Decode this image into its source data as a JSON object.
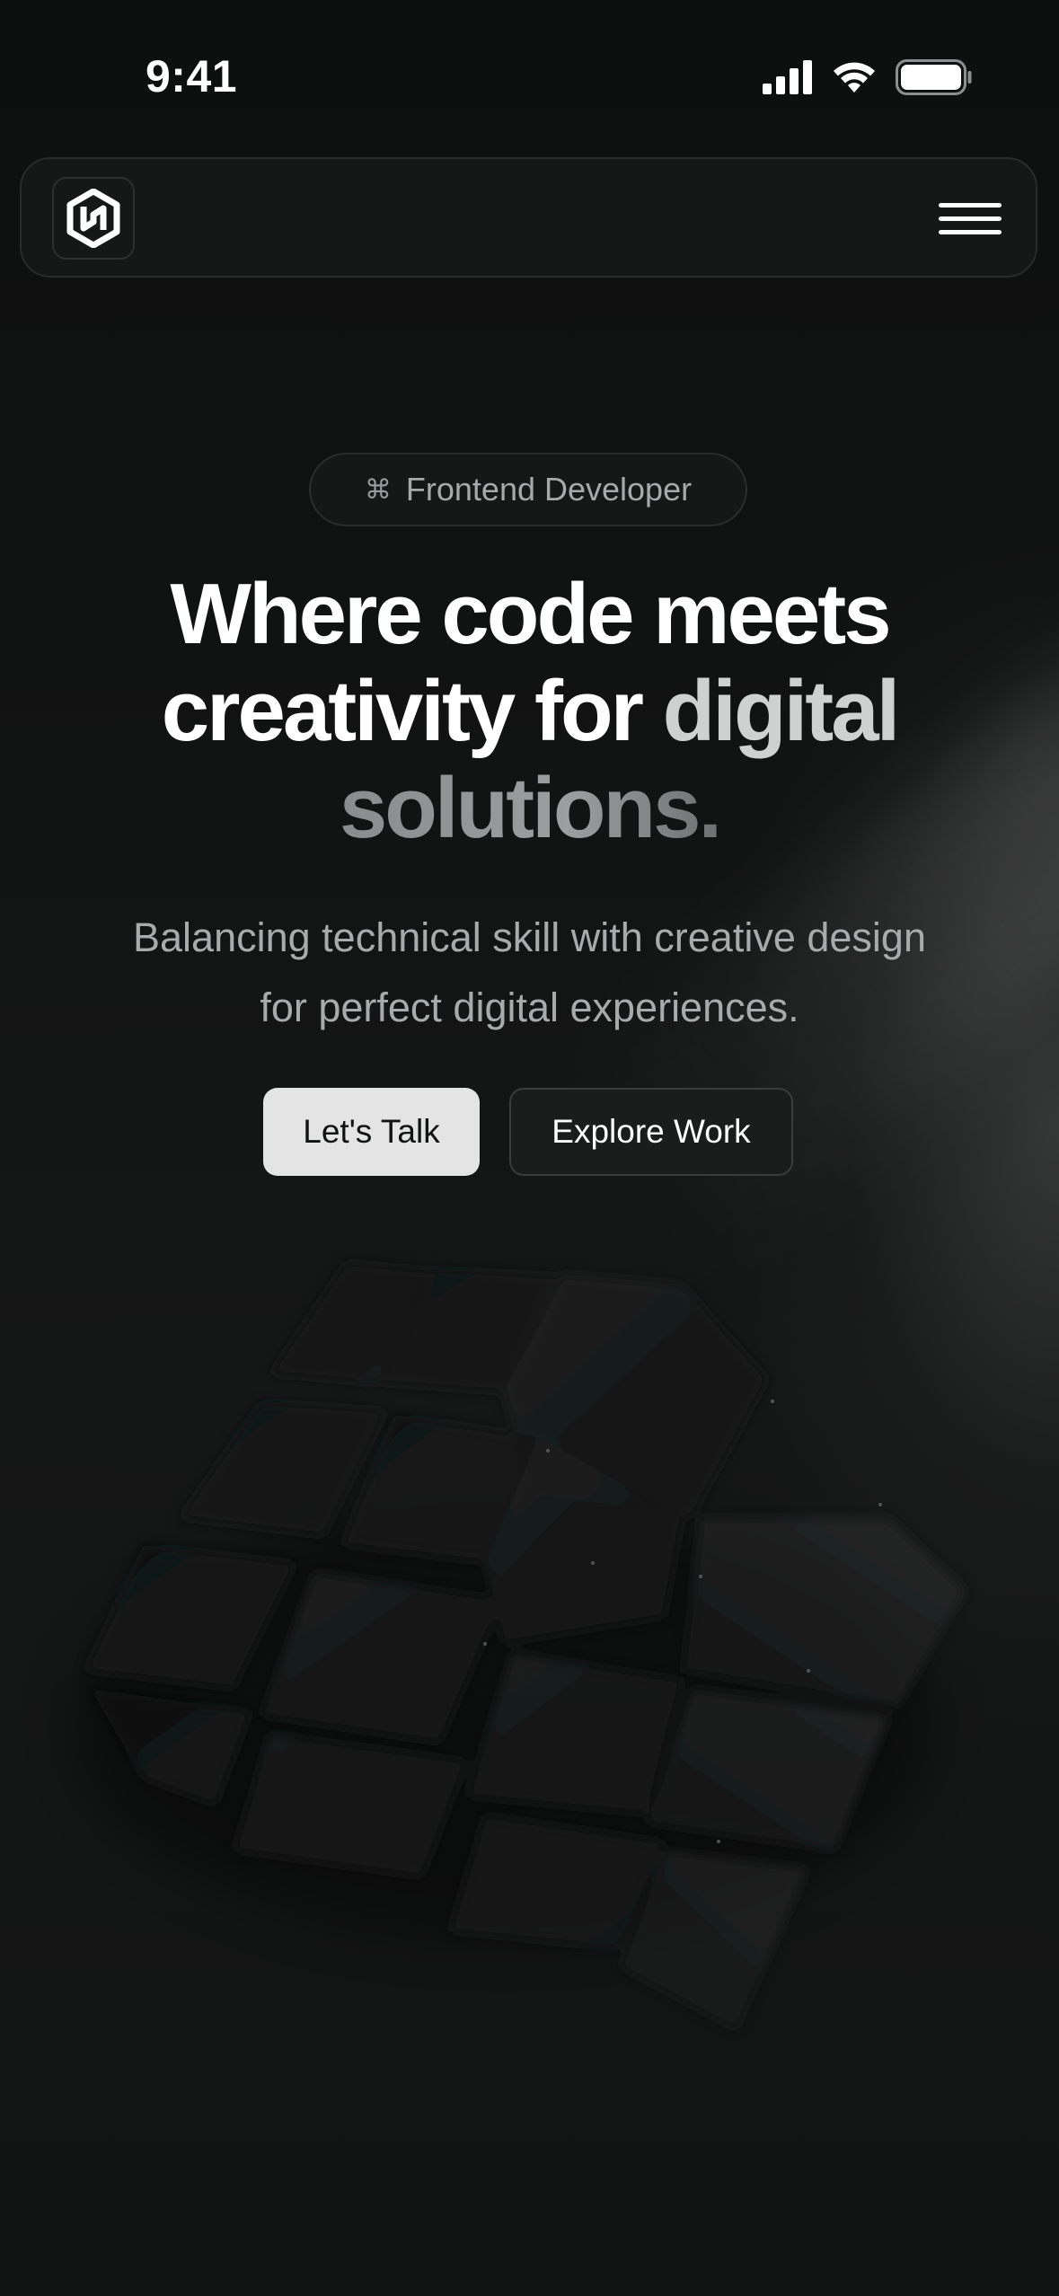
{
  "status_bar": {
    "time": "9:41",
    "icons": [
      "cellular-signal-icon",
      "wifi-icon",
      "battery-icon"
    ]
  },
  "navbar": {
    "logo_icon": "hexagon-logo-icon",
    "menu_icon": "hamburger-menu-icon"
  },
  "hero": {
    "badge": {
      "icon_glyph": "⌘",
      "label": "Frontend Developer"
    },
    "headline": {
      "line1": "Where code meets",
      "line2_white": "creativity for ",
      "line2_gray": "digital",
      "line3": "solutions."
    },
    "subtitle_line1": "Balancing technical skill with creative design",
    "subtitle_line2": "for perfect digital experiences.",
    "primary_cta": "Let's Talk",
    "secondary_cta": "Explore Work"
  },
  "colors": {
    "background": "#0f1010",
    "primary_button_bg": "#e4e4e4",
    "secondary_button_bg": "#1b1c1c",
    "muted_text": "#a9aaab"
  }
}
